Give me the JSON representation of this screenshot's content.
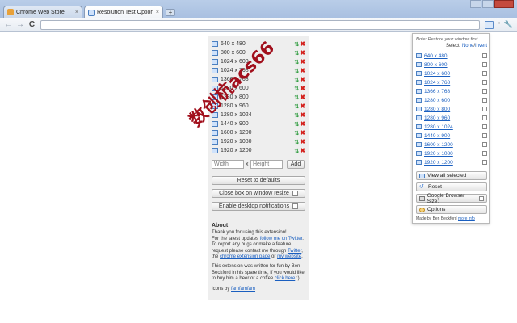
{
  "tabs": [
    {
      "title": "Chrome Web Store",
      "close": "×"
    },
    {
      "title": "Resolution Test Options",
      "close": "×"
    }
  ],
  "toolbar": {
    "back": "←",
    "forward": "→",
    "reload": "C",
    "omnibox_value": "",
    "extension_label": "\""
  },
  "panel": {
    "resolutions": [
      "640 x 480",
      "800 x 600",
      "1024 x 600",
      "1024 x 768",
      "1366 x 768",
      "1280 x 600",
      "1280 x 800",
      "1280 x 960",
      "1280 x 1024",
      "1440 x 900",
      "1600 x 1200",
      "1920 x 1080",
      "1920 x 1200"
    ],
    "width_placeholder": "Width",
    "x_sep": "x",
    "height_placeholder": "Height",
    "add_label": "Add",
    "reset_label": "Reset to defaults",
    "close_box_label": "Close box on window resize",
    "notifications_label": "Enable desktop notifications",
    "about": {
      "heading": "About",
      "p1_a": "Thank you for using this extension!",
      "p1_b": "For the latest updates ",
      "p1_link1": "follow me on Twitter",
      "p1_c": "To report any bugs or make a feature request please contact me through ",
      "p1_link2": "Twitter",
      "p1_d": ", the ",
      "p1_link3": "chrome extension page",
      "p1_e": " or ",
      "p1_link4": "my website",
      "p2_a": "This extension was written for fun by Ben Beckford in his spare time, if you would like to buy him a beer or a coffee ",
      "p2_link": "click here",
      "p2_b": " :)",
      "p3_a": "Icons by ",
      "p3_link": "famfamfam"
    }
  },
  "popup": {
    "note": "Note: Restore your window first",
    "select_label": "Select:",
    "select_none": "None",
    "select_invert": "Invert",
    "view_all_label": "View all selected",
    "reset_label": "Reset",
    "google_size_label": "Google Browser Size:",
    "options_label": "Options",
    "credit_a": "Made by Ben Beckford",
    "credit_link": "more info"
  },
  "watermark": "数创杭acs66"
}
